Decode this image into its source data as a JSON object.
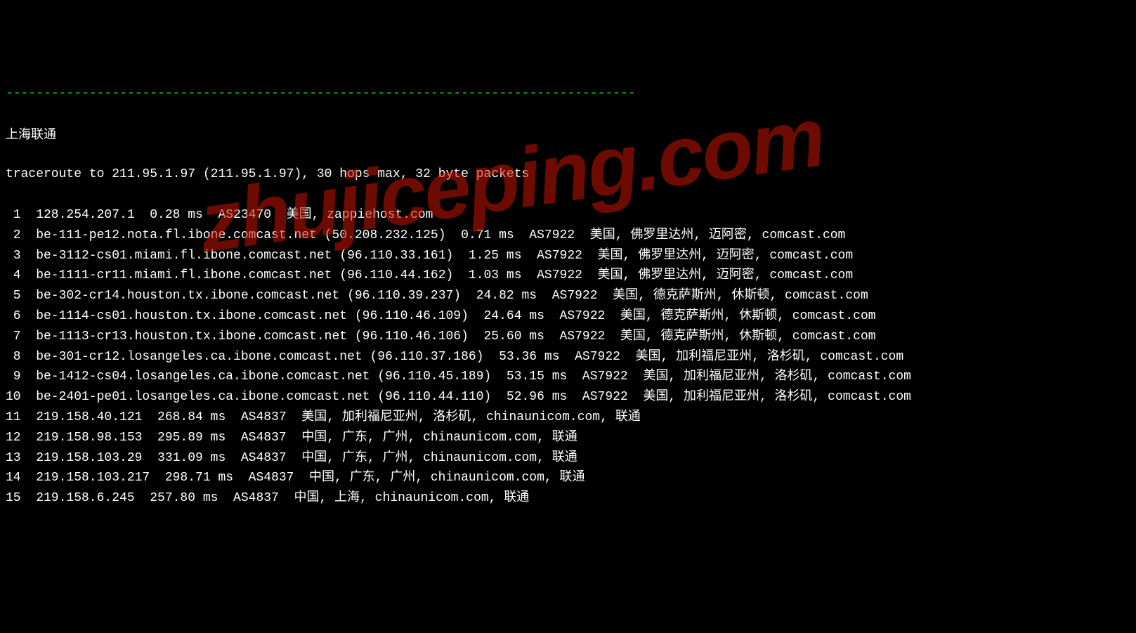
{
  "dashes": "-----------------------------------------------------------------------------------",
  "header": "上海联通",
  "cmd": "traceroute to 211.95.1.97 (211.95.1.97), 30 hops max, 32 byte packets",
  "watermark": "zhujiceping.com",
  "hops": [
    {
      "n": " 1",
      "text": "128.254.207.1  0.28 ms  AS23470  美国, zappiehost.com"
    },
    {
      "n": " 2",
      "text": "be-111-pe12.nota.fl.ibone.comcast.net (50.208.232.125)  0.71 ms  AS7922  美国, 佛罗里达州, 迈阿密, comcast.com"
    },
    {
      "n": " 3",
      "text": "be-3112-cs01.miami.fl.ibone.comcast.net (96.110.33.161)  1.25 ms  AS7922  美国, 佛罗里达州, 迈阿密, comcast.com"
    },
    {
      "n": " 4",
      "text": "be-1111-cr11.miami.fl.ibone.comcast.net (96.110.44.162)  1.03 ms  AS7922  美国, 佛罗里达州, 迈阿密, comcast.com"
    },
    {
      "n": " 5",
      "text": "be-302-cr14.houston.tx.ibone.comcast.net (96.110.39.237)  24.82 ms  AS7922  美国, 德克萨斯州, 休斯顿, comcast.com"
    },
    {
      "n": " 6",
      "text": "be-1114-cs01.houston.tx.ibone.comcast.net (96.110.46.109)  24.64 ms  AS7922  美国, 德克萨斯州, 休斯顿, comcast.com"
    },
    {
      "n": " 7",
      "text": "be-1113-cr13.houston.tx.ibone.comcast.net (96.110.46.106)  25.60 ms  AS7922  美国, 德克萨斯州, 休斯顿, comcast.com"
    },
    {
      "n": " 8",
      "text": "be-301-cr12.losangeles.ca.ibone.comcast.net (96.110.37.186)  53.36 ms  AS7922  美国, 加利福尼亚州, 洛杉矶, comcast.com"
    },
    {
      "n": " 9",
      "text": "be-1412-cs04.losangeles.ca.ibone.comcast.net (96.110.45.189)  53.15 ms  AS7922  美国, 加利福尼亚州, 洛杉矶, comcast.com"
    },
    {
      "n": "10",
      "text": "be-2401-pe01.losangeles.ca.ibone.comcast.net (96.110.44.110)  52.96 ms  AS7922  美国, 加利福尼亚州, 洛杉矶, comcast.com"
    },
    {
      "n": "11",
      "text": "219.158.40.121  268.84 ms  AS4837  美国, 加利福尼亚州, 洛杉矶, chinaunicom.com, 联通"
    },
    {
      "n": "12",
      "text": "219.158.98.153  295.89 ms  AS4837  中国, 广东, 广州, chinaunicom.com, 联通"
    },
    {
      "n": "13",
      "text": "219.158.103.29  331.09 ms  AS4837  中国, 广东, 广州, chinaunicom.com, 联通"
    },
    {
      "n": "14",
      "text": "219.158.103.217  298.71 ms  AS4837  中国, 广东, 广州, chinaunicom.com, 联通"
    },
    {
      "n": "15",
      "text": "219.158.6.245  257.80 ms  AS4837  中国, 上海, chinaunicom.com, 联通"
    }
  ]
}
